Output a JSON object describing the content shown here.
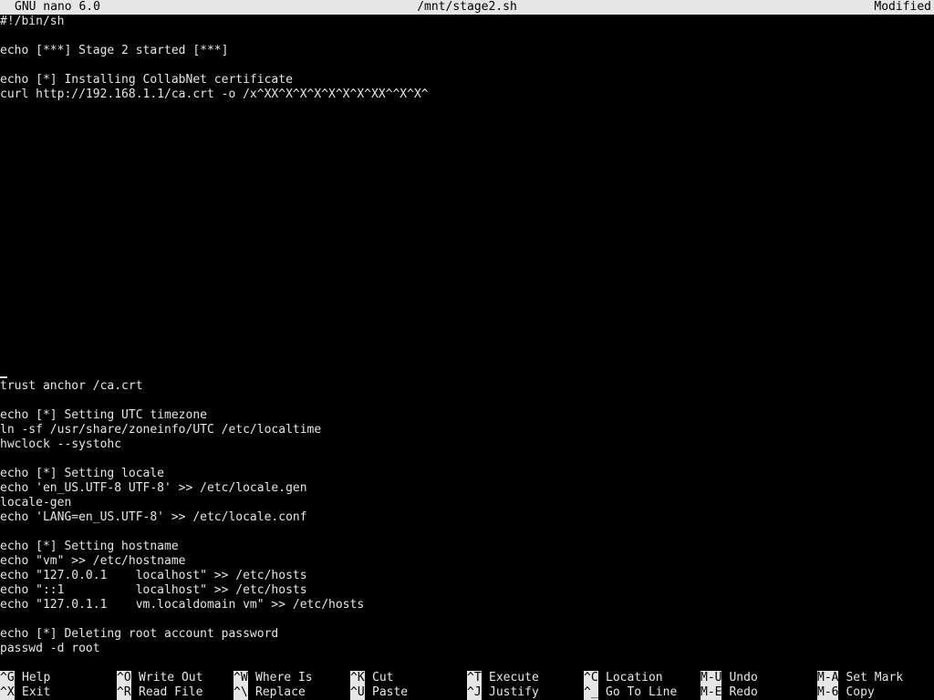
{
  "titlebar": {
    "app": "GNU nano 6.0",
    "filename": "/mnt/stage2.sh",
    "status": "Modified"
  },
  "editor": {
    "lines_top": [
      "#!/bin/sh",
      "",
      "echo [***] Stage 2 started [***]",
      "",
      "echo [*] Installing CollabNet certificate",
      "curl http://192.168.1.1/ca.crt -o /x^XX^X^X^X^X^X^X^XX^^X^X^"
    ],
    "lines_bottom": [
      "trust anchor /ca.crt",
      "",
      "echo [*] Setting UTC timezone",
      "ln -sf /usr/share/zoneinfo/UTC /etc/localtime",
      "hwclock --systohc",
      "",
      "echo [*] Setting locale",
      "echo 'en_US.UTF-8 UTF-8' >> /etc/locale.gen",
      "locale-gen",
      "echo 'LANG=en_US.UTF-8' >> /etc/locale.conf",
      "",
      "echo [*] Setting hostname",
      "echo \"vm\" >> /etc/hostname",
      "echo \"127.0.0.1    localhost\" >> /etc/hosts",
      "echo \"::1          localhost\" >> /etc/hosts",
      "echo \"127.0.1.1    vm.localdomain vm\" >> /etc/hosts",
      "",
      "echo [*] Deleting root account password",
      "passwd -d root"
    ]
  },
  "shortcuts": [
    {
      "key": "^G",
      "label": "Help"
    },
    {
      "key": "^X",
      "label": "Exit"
    },
    {
      "key": "^O",
      "label": "Write Out"
    },
    {
      "key": "^R",
      "label": "Read File"
    },
    {
      "key": "^W",
      "label": "Where Is"
    },
    {
      "key": "^\\",
      "label": "Replace"
    },
    {
      "key": "^K",
      "label": "Cut"
    },
    {
      "key": "^U",
      "label": "Paste"
    },
    {
      "key": "^T",
      "label": "Execute"
    },
    {
      "key": "^J",
      "label": "Justify"
    },
    {
      "key": "^C",
      "label": "Location"
    },
    {
      "key": "^_",
      "label": "Go To Line"
    },
    {
      "key": "M-U",
      "label": "Undo"
    },
    {
      "key": "M-E",
      "label": "Redo"
    },
    {
      "key": "M-A",
      "label": "Set Mark"
    },
    {
      "key": "M-6",
      "label": "Copy"
    }
  ],
  "colors": {
    "background": "#000000",
    "foreground": "#e6e6e6",
    "inverse_background": "#e6e6e6",
    "inverse_foreground": "#000000"
  }
}
